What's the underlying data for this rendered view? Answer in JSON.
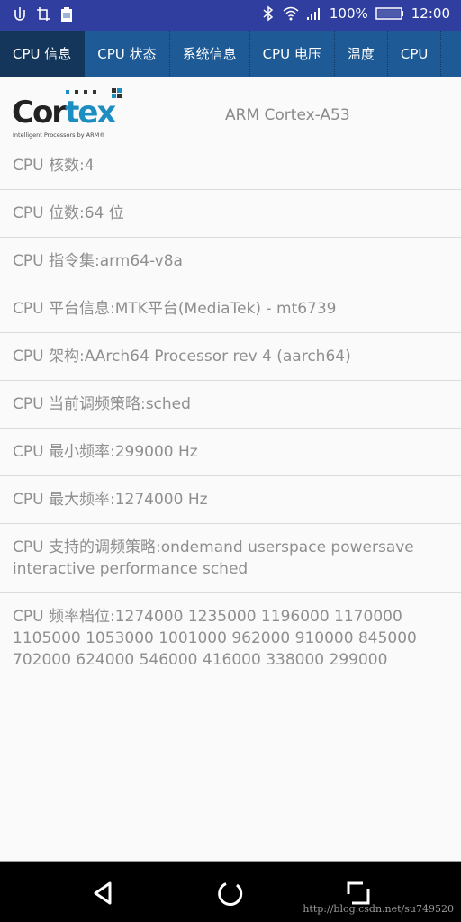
{
  "status_bar": {
    "left_icons": [
      "usb-icon",
      "screenshot-icon",
      "clipboard-icon"
    ],
    "right_icons": [
      "bluetooth-icon",
      "wifi-icon",
      "signal-icon",
      "battery-icon"
    ],
    "battery_percent": "100%",
    "time": "12:00"
  },
  "tabs": [
    {
      "label": "CPU 信息",
      "active": true
    },
    {
      "label": "CPU 状态",
      "active": false
    },
    {
      "label": "系统信息",
      "active": false
    },
    {
      "label": "CPU 电压",
      "active": false
    },
    {
      "label": "温度",
      "active": false
    },
    {
      "label": "CPU",
      "active": false
    }
  ],
  "header": {
    "logo_text_dark": "Cor",
    "logo_text_blue": "tex",
    "logo_tagline": "Intelligent Processors by ARM®",
    "model": "ARM Cortex-A53"
  },
  "info_rows": [
    {
      "label": "CPU 核数:",
      "value": "4"
    },
    {
      "label": "CPU 位数:",
      "value": "64 位"
    },
    {
      "label": "CPU 指令集:",
      "value": "arm64-v8a"
    },
    {
      "label": "CPU 平台信息:",
      "value": "MTK平台(MediaTek) - mt6739"
    },
    {
      "label": "CPU 架构:",
      "value": "AArch64 Processor rev 4 (aarch64)"
    },
    {
      "label": "CPU 当前调频策略:",
      "value": "sched"
    },
    {
      "label": "CPU 最小频率:",
      "value": "299000 Hz"
    },
    {
      "label": "CPU 最大频率:",
      "value": "1274000 Hz"
    },
    {
      "label": "CPU 支持的调频策略:",
      "value": "ondemand userspace powersave interactive performance sched"
    },
    {
      "label": "CPU 频率档位:",
      "value": "1274000 1235000 1196000 1170000 1105000 1053000 1001000 962000 910000 845000 702000 624000 546000 416000 338000 299000"
    }
  ],
  "nav_bar": {
    "buttons": [
      "back-icon",
      "home-icon",
      "recents-icon"
    ],
    "watermark": "http://blog.csdn.net/su749520"
  },
  "colors": {
    "status_bar": "#303f9f",
    "tab_bar": "#1e5a96",
    "tab_active": "#13365a",
    "text_gray": "#8f8f8f",
    "logo_blue": "#1d8ec1"
  }
}
